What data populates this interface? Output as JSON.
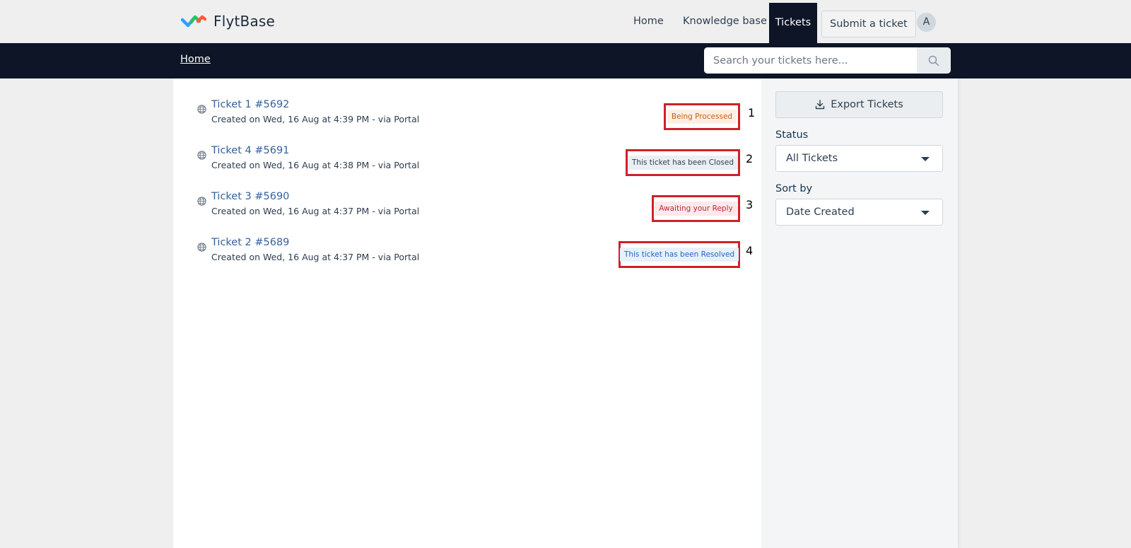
{
  "header": {
    "brand": "FlytBase",
    "nav": {
      "home": "Home",
      "knowledge_base": "Knowledge base",
      "tickets": "Tickets",
      "submit": "Submit a ticket"
    },
    "avatar_initial": "A"
  },
  "subbar": {
    "breadcrumb": "Home",
    "search_placeholder": "Search your tickets here..."
  },
  "tickets": [
    {
      "title": "Ticket 1 #5692",
      "meta": "Created on Wed, 16 Aug at 4:39 PM - via Portal",
      "status": "Being Processed",
      "marker": "1"
    },
    {
      "title": "Ticket 4 #5691",
      "meta": "Created on Wed, 16 Aug at 4:38 PM - via Portal",
      "status": "This ticket has been Closed",
      "marker": "2"
    },
    {
      "title": "Ticket 3 #5690",
      "meta": "Created on Wed, 16 Aug at 4:37 PM - via Portal",
      "status": "Awaiting your Reply",
      "marker": "3"
    },
    {
      "title": "Ticket 2 #5689",
      "meta": "Created on Wed, 16 Aug at 4:37 PM - via Portal",
      "status": "This ticket has been Resolved",
      "marker": "4"
    }
  ],
  "sidebar": {
    "export_label": "Export Tickets",
    "status_label": "Status",
    "status_value": "All Tickets",
    "sort_label": "Sort by",
    "sort_value": "Date Created"
  },
  "colors": {
    "navy": "#0d1526",
    "highlight": "#d0202a",
    "processed_bg": "#fdf0e3",
    "processed_text": "#c75a1b",
    "closed_bg": "#ebeff3",
    "closed_text": "#2c3e50",
    "awaiting_bg": "#fce9ec",
    "awaiting_text": "#c5253b",
    "resolved_bg": "#e5f2fd",
    "resolved_text": "#2c5cc5"
  },
  "icons": {
    "logo": "flytbase-logo",
    "ticket": "globe-icon",
    "search": "search-icon",
    "export": "download-icon",
    "select": "caret-down-icon"
  }
}
